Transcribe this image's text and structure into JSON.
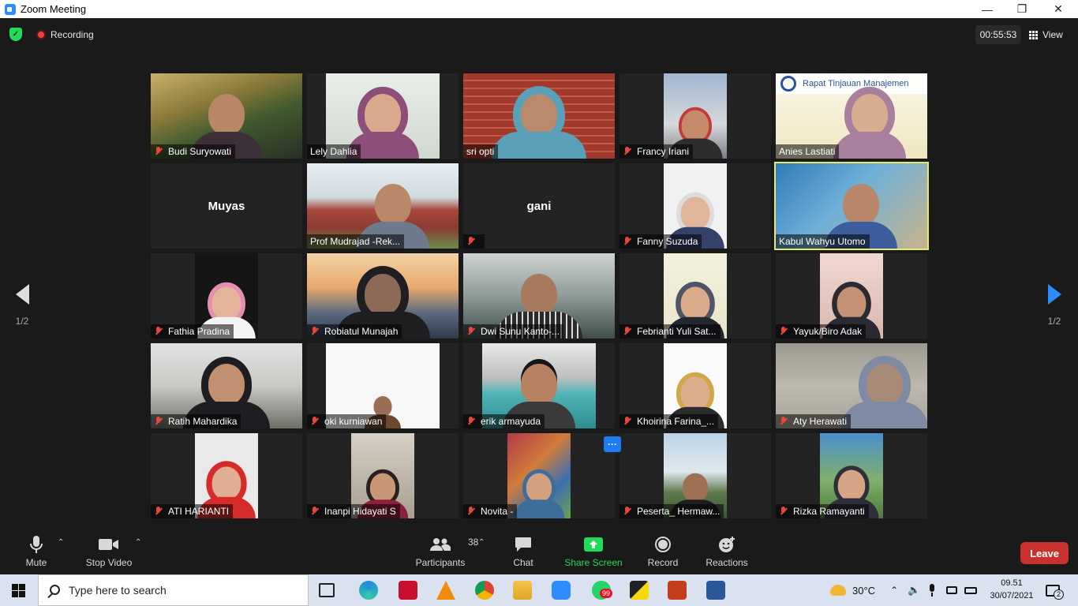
{
  "window": {
    "title": "Zoom Meeting",
    "controls": {
      "minimize": "—",
      "maximize": "❐",
      "close": "✕"
    }
  },
  "topbar": {
    "recording_label": "Recording",
    "timer": "00:55:53",
    "view_label": "View"
  },
  "pagination": {
    "left": "1/2",
    "right": "1/2"
  },
  "participants": [
    {
      "name": "Budi Suryowati",
      "muted": true
    },
    {
      "name": "Lely Dahlia",
      "muted": false
    },
    {
      "name": "sri opti",
      "muted": false
    },
    {
      "name": "Francy Iriani",
      "muted": true
    },
    {
      "name": "Anies Lastiati",
      "muted": false,
      "banner": "Rapat Tinjauan Manajemen"
    },
    {
      "name": "Muyas",
      "video_off": true,
      "muted": false
    },
    {
      "name": "Prof Mudrajad -Rek...",
      "muted": false
    },
    {
      "name": "gani",
      "video_off": true,
      "muted": true
    },
    {
      "name": "Fanny Suzuda",
      "muted": true
    },
    {
      "name": "Kabul Wahyu Utomo",
      "muted": false,
      "active_speaker": true
    },
    {
      "name": "Fathia Pradina",
      "muted": true
    },
    {
      "name": "Robiatul Munajah",
      "muted": true
    },
    {
      "name": "Dwi Sunu Kanto-...",
      "muted": true
    },
    {
      "name": "Febrianti Yuli Sat...",
      "muted": true
    },
    {
      "name": "Yayuk/Biro Adak",
      "muted": true
    },
    {
      "name": "Ratih Mahardika",
      "muted": true
    },
    {
      "name": "oki kurniawan",
      "muted": true
    },
    {
      "name": "erik armayuda",
      "muted": true
    },
    {
      "name": "Khoirina Farina_...",
      "muted": true
    },
    {
      "name": "Aty Herawati",
      "muted": true
    },
    {
      "name": "ATI HARIANTI",
      "muted": true
    },
    {
      "name": "Inanpi Hidayati S",
      "muted": true
    },
    {
      "name": "Novita -",
      "muted": true,
      "more_button": "···"
    },
    {
      "name": "Peserta_ Hermaw...",
      "muted": true
    },
    {
      "name": "Rizka Ramayanti",
      "muted": true
    }
  ],
  "toolbar": {
    "mute": "Mute",
    "stop_video": "Stop Video",
    "participants": "Participants",
    "participants_count": "38",
    "chat": "Chat",
    "share_screen": "Share Screen",
    "record": "Record",
    "reactions": "Reactions",
    "leave": "Leave",
    "share_color": "#23d959",
    "leave_color": "#c8312d"
  },
  "taskbar": {
    "search_placeholder": "Type here to search",
    "weather": "30°C",
    "time": "09.51",
    "date": "30/07/2021",
    "notifications": "2",
    "whatsapp_badge": "99"
  }
}
